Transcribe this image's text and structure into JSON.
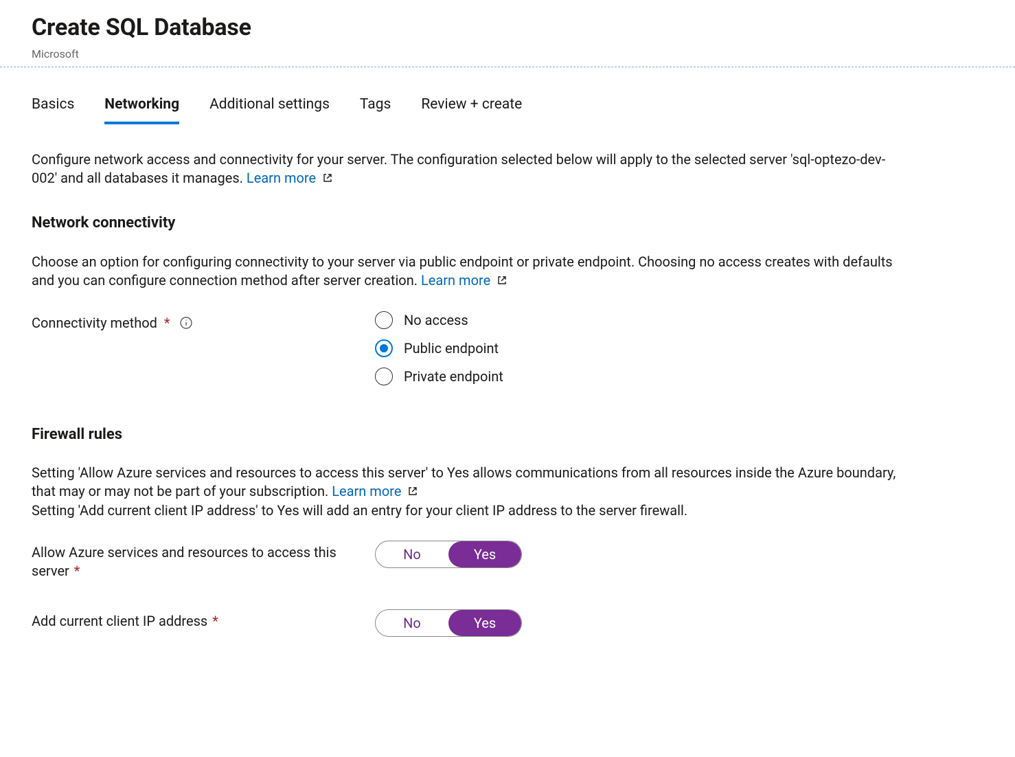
{
  "header": {
    "title": "Create SQL Database",
    "publisher": "Microsoft"
  },
  "tabs": [
    {
      "label": "Basics",
      "active": false
    },
    {
      "label": "Networking",
      "active": true
    },
    {
      "label": "Additional settings",
      "active": false
    },
    {
      "label": "Tags",
      "active": false
    },
    {
      "label": "Review + create",
      "active": false
    }
  ],
  "intro": {
    "text": "Configure network access and connectivity for your server. The configuration selected below will apply to the selected server 'sql-optezo-dev-002' and all databases it manages. ",
    "learn_more": "Learn more"
  },
  "network": {
    "title": "Network connectivity",
    "desc": "Choose an option for configuring connectivity to your server via public endpoint or private endpoint. Choosing no access creates with defaults and you can configure connection method after server creation. ",
    "learn_more": "Learn more",
    "field_label": "Connectivity method",
    "options": {
      "no_access": "No access",
      "public": "Public endpoint",
      "private": "Private endpoint"
    },
    "selected": "public"
  },
  "firewall": {
    "title": "Firewall rules",
    "desc_line1_a": "Setting 'Allow Azure services and resources to access this server' to Yes allows communications from all resources inside the Azure boundary, that may or may not be part of your subscription. ",
    "learn_more": "Learn more",
    "desc_line2": "Setting 'Add current client IP address' to Yes will add an entry for your client IP address to the server firewall.",
    "rows": {
      "allow_azure_label": "Allow Azure services and resources to access this server",
      "add_ip_label": "Add current client IP address"
    },
    "toggle": {
      "no": "No",
      "yes": "Yes"
    },
    "allow_azure_value": "yes",
    "add_ip_value": "yes"
  }
}
